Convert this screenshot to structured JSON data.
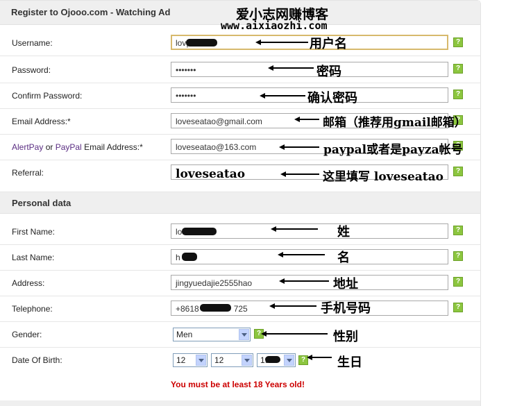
{
  "header": {
    "title": "Register to Ojooo.com - Watching Ad"
  },
  "watermark": {
    "line1": "爱小志网赚博客",
    "line2": "www.aixiaozhi.com"
  },
  "account": {
    "username": {
      "label": "Username:",
      "value": "lov|"
    },
    "password": {
      "label": "Password:",
      "value": "•••••••"
    },
    "confirm_password": {
      "label": "Confirm Password:",
      "value": "•••••••"
    },
    "email": {
      "label": "Email Address:*",
      "value": "loveseatao@gmail.com"
    },
    "paypal": {
      "label_alertpay": "AlertPay",
      "label_or": " or ",
      "label_paypal": "PayPal",
      "label_rest": " Email Address:*",
      "value": "loveseatao@163.com"
    },
    "referral": {
      "label": "Referral:",
      "value": ""
    }
  },
  "personal": {
    "section_title": "Personal data",
    "first_name": {
      "label": "First Name:",
      "value": "lo"
    },
    "last_name": {
      "label": "Last Name:",
      "value": "h"
    },
    "address": {
      "label": "Address:",
      "value": "jingyuedajie2555hao"
    },
    "telephone": {
      "label": "Telephone:",
      "value": "+8618",
      "value_end": "725"
    },
    "gender": {
      "label": "Gender:",
      "value": "Men"
    },
    "dob": {
      "label": "Date Of Birth:",
      "month": "12",
      "day": "12",
      "year": "19"
    },
    "warning": "You must be at least 18 Years old!"
  },
  "help_glyph": "?",
  "annotations": {
    "username": "用户名",
    "password": "密码",
    "confirm": "确认密码",
    "email": "邮箱（推荐用gmail邮箱）",
    "paypal": "paypal或者是payza帐号",
    "referral_value": "loveseatao",
    "referral": "这里填写 loveseatao",
    "first_name": "姓",
    "last_name": "名",
    "address": "地址",
    "telephone": "手机号码",
    "gender": "性别",
    "dob": "生日"
  }
}
